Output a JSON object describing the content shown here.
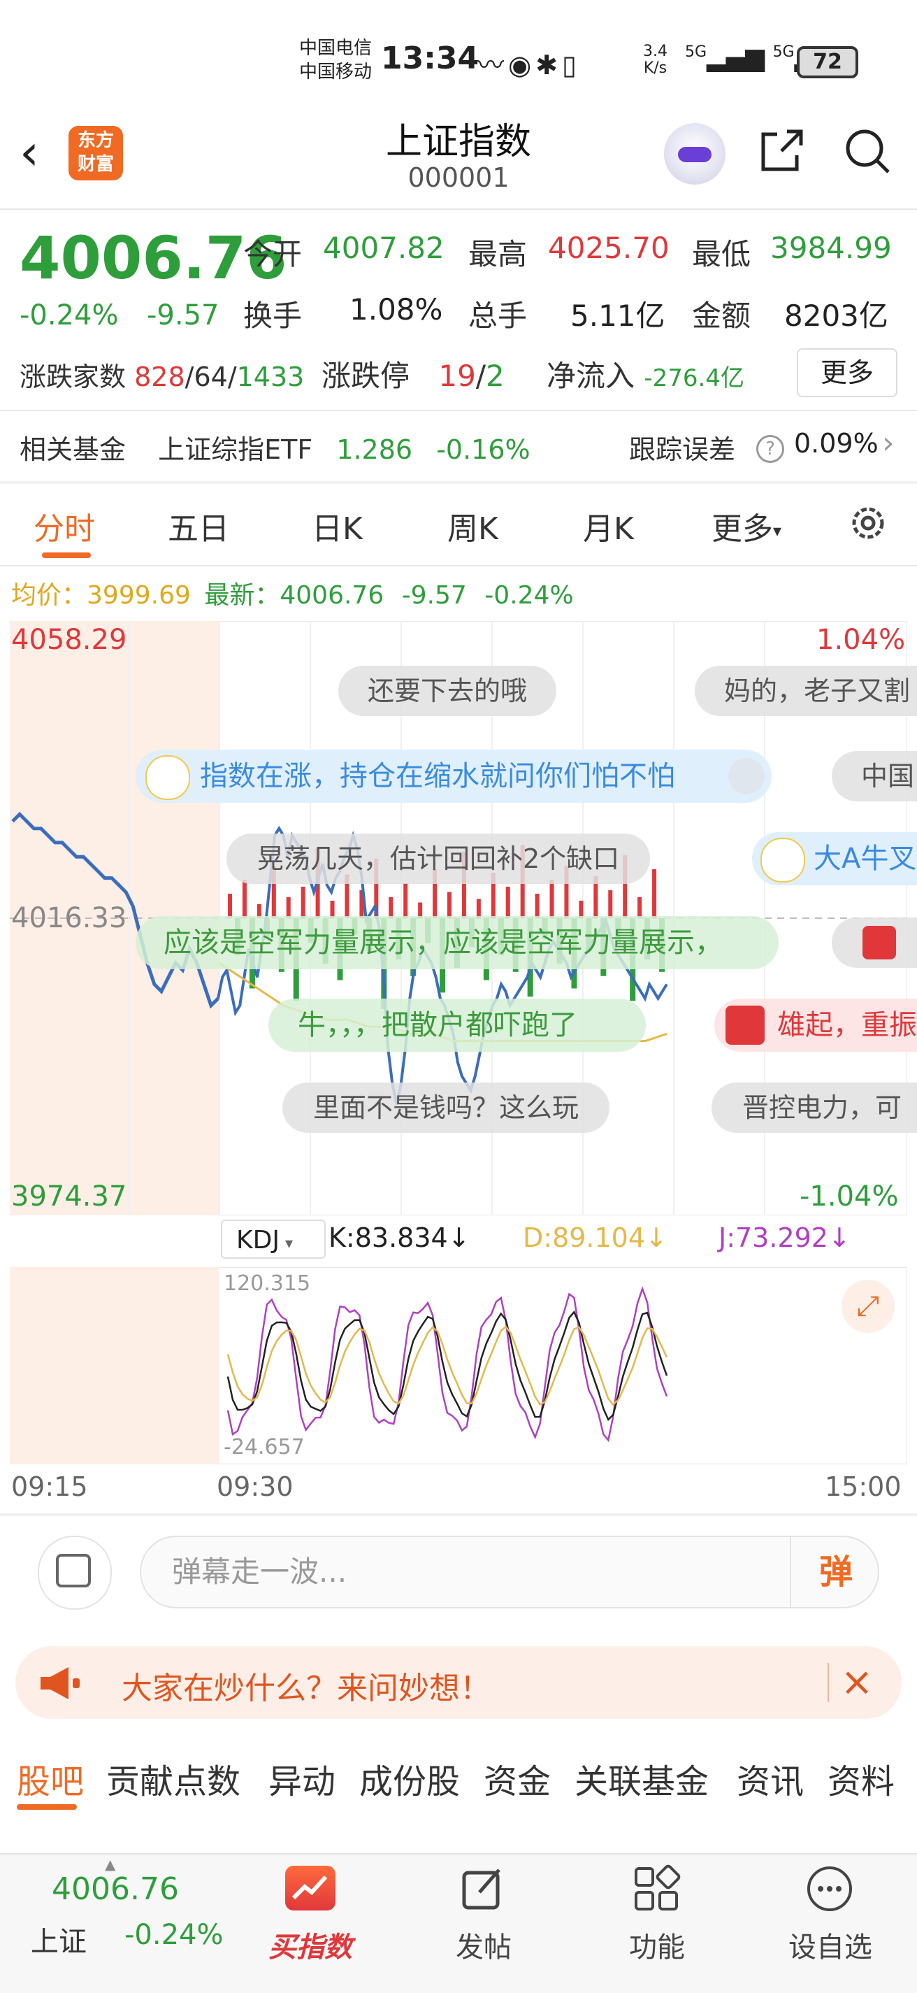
{
  "status_bar": {
    "carrier1": "中国电信",
    "carrier2": "中国移动",
    "time": "13:34",
    "net_speed_value": "3.4",
    "net_speed_unit": "K/s",
    "net1": "5G",
    "net2": "5G",
    "battery": "72"
  },
  "header": {
    "logo_line1": "东方",
    "logo_line2": "财富",
    "title": "上证指数",
    "code": "000001"
  },
  "quote": {
    "price": "4006.76",
    "change_pct": "-0.24%",
    "change_val": "-9.57",
    "open_label": "今开",
    "open": "4007.82",
    "high_label": "最高",
    "high": "4025.70",
    "low_label": "最低",
    "low": "3984.99",
    "turnover_label": "换手",
    "turnover": "1.08%",
    "volume_label": "总手",
    "volume": "5.11亿",
    "amount_label": "金额",
    "amount": "8203亿",
    "breadth_label": "涨跌家数",
    "up_count": "828",
    "flat_count": "64",
    "down_count": "1433",
    "limit_label": "涨跌停",
    "limit_up": "19",
    "limit_down": "2",
    "inflow_label": "净流入",
    "inflow": "-276.4亿",
    "more_label": "更多"
  },
  "fund": {
    "label": "相关基金",
    "name": "上证综指ETF",
    "price": "1.286",
    "change": "-0.16%",
    "tracking_label": "跟踪误差",
    "tracking": "0.09%"
  },
  "tabs": [
    "分时",
    "五日",
    "日K",
    "周K",
    "月K",
    "更多"
  ],
  "avg_line": {
    "avg_label": "均价：",
    "avg": "3999.69",
    "latest_label": "最新：",
    "latest": "4006.76",
    "chg": "-9.57",
    "pct": "-0.24%"
  },
  "chart_data": {
    "type": "line",
    "y_top": "4058.29",
    "y_mid": "4016.33",
    "y_bottom": "3974.37",
    "pct_top": "1.04%",
    "pct_bottom": "-1.04%",
    "x_labels": [
      "09:15",
      "09:30",
      "15:00"
    ],
    "ylim": [
      3974.37,
      4058.29
    ],
    "series": [
      {
        "values": [
          4030,
          4031,
          4030,
          4029,
          4029,
          4028,
          4027,
          4027,
          4026,
          4025,
          4025,
          4024,
          4023,
          4022,
          4022,
          4021,
          4020,
          4018,
          4014,
          4010,
          4007,
          4006,
          4008,
          4010,
          4009,
          4012,
          4010,
          4007,
          4004,
          4005,
          4008,
          4009,
          4006,
          4003,
          4004,
          4008,
          4012,
          4010,
          4008,
          4012,
          4016,
          4022,
          4028,
          4029,
          4028,
          4025,
          4028,
          4027,
          4026,
          4025,
          4022,
          4020,
          4022,
          4024,
          4021,
          4020,
          4022,
          4023,
          4025,
          4026,
          4028,
          4026,
          4022,
          4016,
          4017,
          4018,
          4015,
          4008,
          3998,
          3993,
          3990,
          3993,
          3998,
          4005,
          4009,
          4010,
          4012,
          4011,
          4010,
          4008,
          4005,
          4004,
          4002,
          4000,
          3996,
          3994,
          3993,
          3992,
          3994,
          3997,
          4000,
          4002,
          4004,
          4005,
          4007,
          4006,
          4004,
          4005,
          4006,
          4007,
          4008,
          4010,
          4009,
          4008,
          4010,
          4012,
          4013,
          4012,
          4011,
          4010,
          4008,
          4009,
          4010,
          4011,
          4012,
          4013,
          4014,
          4015,
          4016,
          4014,
          4012,
          4011,
          4010,
          4009,
          4008,
          4007,
          4006,
          4005,
          4007,
          4006,
          4005,
          4006,
          4007
        ]
      },
      {
        "values": [
          4010,
          4008,
          4006,
          4004,
          4003,
          4002,
          4002,
          4001,
          4001,
          4000,
          4000,
          3999,
          3999,
          3999,
          3999,
          3999,
          3999,
          3999,
          3999,
          3999,
          3999,
          4000
        ]
      }
    ],
    "volume_up": [
      14,
      22,
      8,
      30,
      12,
      18,
      40,
      10,
      25,
      16,
      34,
      12,
      20,
      9,
      28,
      15,
      38,
      11,
      26,
      18,
      42,
      14,
      22,
      30,
      10,
      24,
      16,
      36,
      12,
      28
    ],
    "volume_down": [
      18,
      34,
      10,
      26,
      40,
      12,
      22,
      30,
      8,
      16,
      44,
      20,
      28,
      12,
      36,
      24,
      14,
      30,
      18,
      26,
      38,
      10,
      22,
      34,
      16,
      28,
      12,
      40,
      20,
      26
    ]
  },
  "danmaku": [
    "还要下去的哦",
    "妈的，老子又割",
    "指数在涨，持仓在缩水就问你们怕不怕",
    "中国",
    "晃荡几天，估计回回补2个缺口",
    "大A牛叉",
    "应该是空军力量展示，应该是空军力量展示，",
    "牛，，，把散户都吓跑了",
    "雄起，重振",
    "里面不是钱吗？这么玩",
    "晋控电力，可"
  ],
  "kdj": {
    "label": "KDJ",
    "k": "K:83.834↓",
    "d": "D:89.104↓",
    "j": "J:73.292↓",
    "top": "120.315",
    "bottom": "-24.657"
  },
  "danmaku_input": {
    "placeholder": "弹幕走一波...",
    "send": "弹"
  },
  "banner": {
    "text": "大家在炒什么？来问妙想！"
  },
  "bottom_tabs": [
    "股吧",
    "贡献点数",
    "异动",
    "成份股",
    "资金",
    "关联基金",
    "资讯",
    "资料"
  ],
  "nav": {
    "price": "4006.76",
    "name": "上证",
    "change": "-0.24%",
    "buy": "买指数",
    "post": "发帖",
    "func": "功能",
    "watch": "设自选"
  },
  "colors": {
    "up": "#e0383a",
    "down": "#2e9e3b",
    "accent": "#f06a24",
    "price_line": "#3b6dbd",
    "avg_line": "#e6b84a",
    "k_line": "#222222",
    "d_line": "#e6b84a",
    "j_line": "#b03fc4"
  }
}
